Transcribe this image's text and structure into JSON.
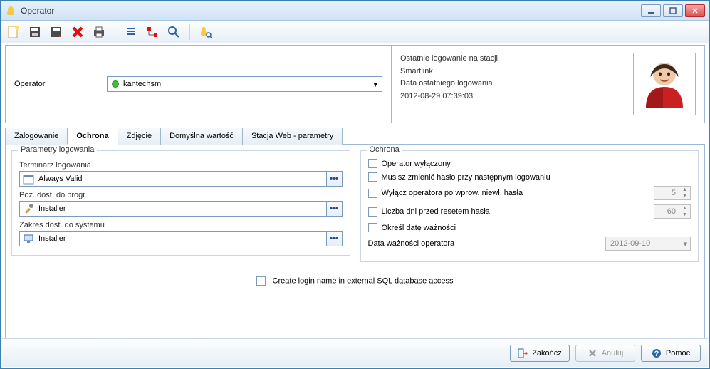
{
  "window": {
    "title": "Operator"
  },
  "header": {
    "operator_label": "Operator",
    "operator_value": "kantechsml",
    "login_line1": "Ostatnie logowanie na stacji :",
    "login_station": "Smartlink",
    "login_date_label": "Data ostatniego logowania",
    "login_date_value": "2012-08-29 07:39:03"
  },
  "tabs": {
    "t1": "Zalogowanie",
    "t2": "Ochrona",
    "t3": "Zdjęcie",
    "t4": "Domyślna wartość",
    "t5": "Stacja Web - parametry"
  },
  "left": {
    "group": "Parametry logowania",
    "sched_label": "Terminarz logowania",
    "sched_value": "Always Valid",
    "prog_label": "Poz. dost. do progr.",
    "prog_value": "Installer",
    "sys_label": "Zakres dost. do systemu",
    "sys_value": "Installer"
  },
  "right": {
    "group": "Ochrona",
    "c1": "Operator wyłączony",
    "c2": "Musisz zmienić hasło przy następnym logowaniu",
    "c3": "Wyłącz operatora po wprow. niewł. hasła",
    "c3_val": "5",
    "c4": "Liczba dni przed resetem hasła",
    "c4_val": "60",
    "c5": "Określ datę ważności",
    "exp_label": "Data ważności operatora",
    "exp_value": "2012-09-10"
  },
  "sql_checkbox": "Create login name in external SQL database access",
  "footer": {
    "close": "Zakończ",
    "cancel": "Anuluj",
    "help": "Pomoc"
  }
}
